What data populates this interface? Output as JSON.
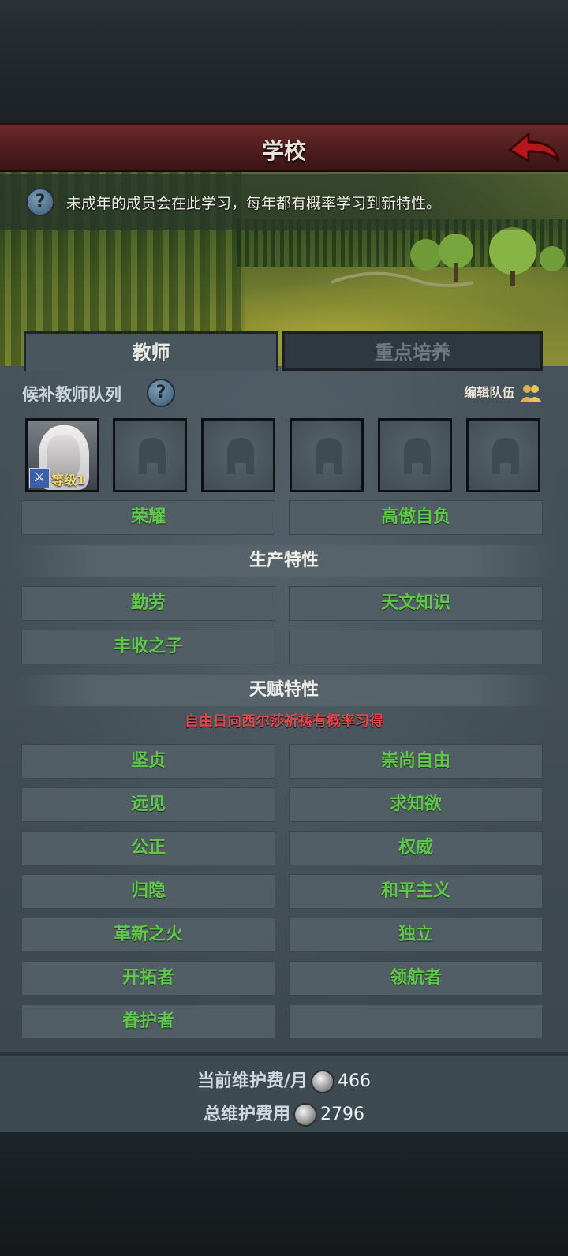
{
  "header": {
    "title": "学校"
  },
  "info": {
    "text": "未成年的成员会在此学习，每年都有概率学习到新特性。"
  },
  "tabs": [
    {
      "label": "教师",
      "active": true
    },
    {
      "label": "重点培养",
      "active": false
    }
  ],
  "reserve": {
    "label": "候补教师队列",
    "edit_label": "编辑队伍"
  },
  "slots": [
    {
      "filled": true,
      "level_label": "等级1"
    },
    {
      "filled": false
    },
    {
      "filled": false
    },
    {
      "filled": false
    },
    {
      "filled": false
    },
    {
      "filled": false
    }
  ],
  "traits_top": [
    "荣耀",
    "高傲自负"
  ],
  "production": {
    "title": "生产特性",
    "items": [
      "勤劳",
      "天文知识",
      "丰收之子",
      ""
    ]
  },
  "talent": {
    "title": "天赋特性",
    "note": "自由日向西尔莎祈祷有概率习得",
    "items": [
      "坚贞",
      "崇尚自由",
      "远见",
      "求知欲",
      "公正",
      "权威",
      "归隐",
      "和平主义",
      "革新之火",
      "独立",
      "开拓者",
      "领航者",
      "眷护者",
      ""
    ]
  },
  "footer": {
    "monthly_label": "当前维护费/月",
    "monthly_value": "466",
    "total_label": "总维护费用",
    "total_value": "2796"
  },
  "colors": {
    "trait_green": "#5fc84a",
    "note_red": "#e0474a",
    "header_red": "#5a2224"
  },
  "icons": [
    "question-icon",
    "back-arrow-icon",
    "people-icon",
    "helmet-icon",
    "sword-icon",
    "silver-coin-icon"
  ]
}
